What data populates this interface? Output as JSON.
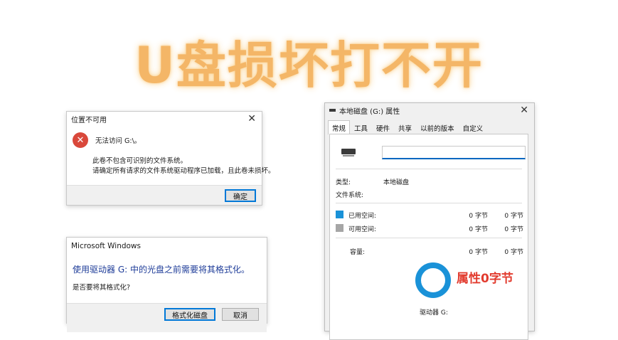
{
  "headline": "U盘损坏打不开",
  "dialog_unavailable": {
    "title": "位置不可用",
    "line1": "无法访问 G:\\。",
    "line2": "此卷不包含可识别的文件系统。",
    "line3": "请确定所有请求的文件系统驱动程序已加载，且此卷未损坏。",
    "ok_label": "确定"
  },
  "dialog_format": {
    "title": "Microsoft Windows",
    "heading": "使用驱动器 G: 中的光盘之前需要将其格式化。",
    "question": "是否要将其格式化?",
    "format_label": "格式化磁盘",
    "cancel_label": "取消"
  },
  "properties": {
    "title": "本地磁盘 (G:) 属性",
    "tabs": [
      "常规",
      "工具",
      "硬件",
      "共享",
      "以前的版本",
      "自定义"
    ],
    "name_value": "",
    "type_label": "类型:",
    "type_value": "本地磁盘",
    "fs_label": "文件系统:",
    "fs_value": "",
    "used_label": "已用空间:",
    "used_bytes": "0 字节",
    "used_size": "0 字节",
    "free_label": "可用空间:",
    "free_bytes": "0 字节",
    "free_size": "0 字节",
    "capacity_label": "容量:",
    "capacity_bytes": "0 字节",
    "capacity_size": "0 字节",
    "annotation": "属性0字节",
    "drive_label": "驱动器 G:"
  },
  "colors": {
    "headline": "#f4b667",
    "used_swatch": "#1a92d8",
    "free_swatch": "#a6a6a6",
    "annotation": "#e23b2e"
  }
}
